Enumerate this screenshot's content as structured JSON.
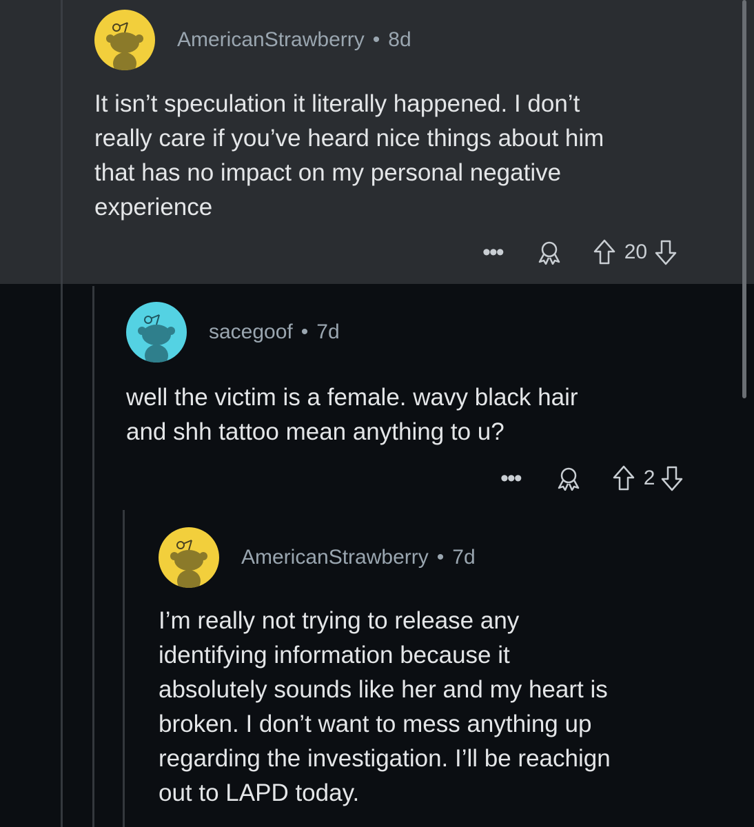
{
  "comments": [
    {
      "username": "AmericanStrawberry",
      "separator": "•",
      "age": "8d",
      "text": "It isn’t speculation it literally happened. I don’t\nreally care if you’ve heard nice things about him\nthat has no impact on my personal negative\nexperience",
      "more_label": "•••",
      "award_icon": "award-icon",
      "upvote_icon": "upvote-arrow-icon",
      "score": "20",
      "downvote_icon": "downvote-arrow-icon",
      "avatar_color": "#f2cf3c",
      "highlighted": true
    },
    {
      "username": "sacegoof",
      "separator": "•",
      "age": "7d",
      "text": "well the victim is a female. wavy black hair\nand shh tattoo mean anything to u?",
      "more_label": "•••",
      "award_icon": "award-icon",
      "upvote_icon": "upvote-arrow-icon",
      "score": "2",
      "downvote_icon": "downvote-arrow-icon",
      "avatar_color": "#54d2e3",
      "highlighted": false
    },
    {
      "username": "AmericanStrawberry",
      "separator": "•",
      "age": "7d",
      "text": "I’m really not trying to release any\nidentifying information because it\nabsolutely sounds like her and my heart is\nbroken. I don’t want to mess anything up\nregarding the investigation. I’ll be reachign\nout to LAPD today.",
      "avatar_color": "#f2cf3c",
      "highlighted": false
    }
  ],
  "colors": {
    "background": "#0b0e12",
    "highlight_background": "#2a2d31",
    "username_text": "#9aa6b0",
    "body_text": "#e4e6e8",
    "snoo_body": "#8b7a2a"
  }
}
